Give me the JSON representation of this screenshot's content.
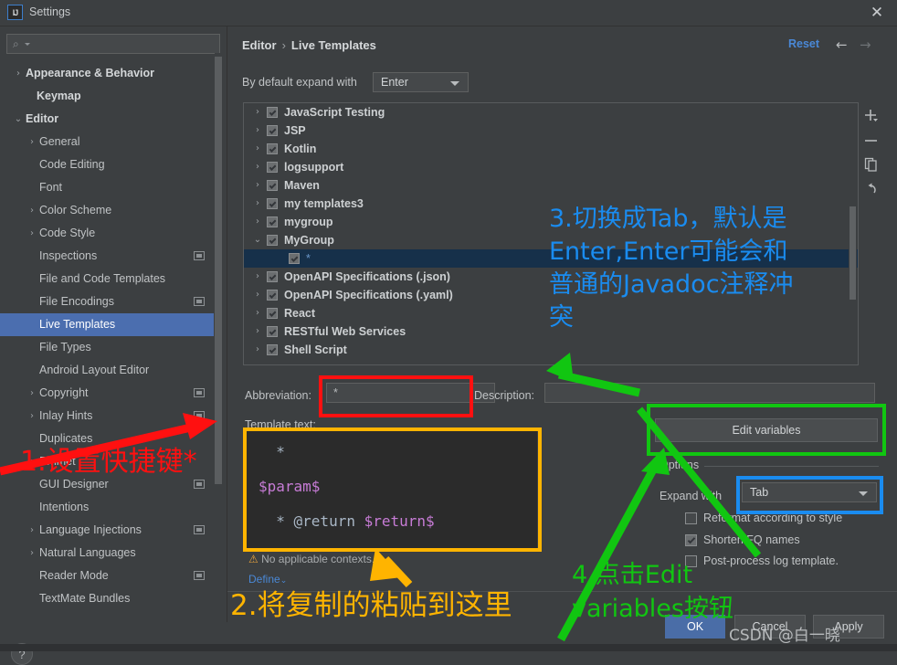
{
  "window": {
    "title": "Settings",
    "app_icon": "IJ",
    "close_icon": "✕"
  },
  "sidebar": {
    "search_placeholder": "",
    "search_icon": "⌕",
    "items": [
      {
        "label": "Appearance & Behavior",
        "arrow": "›",
        "indent": 14,
        "bold": true,
        "chip": false,
        "selected": false
      },
      {
        "label": "Keymap",
        "arrow": "",
        "indent": 40,
        "bold": true,
        "chip": false,
        "selected": false
      },
      {
        "label": "Editor",
        "arrow": "⌄",
        "indent": 14,
        "bold": true,
        "chip": false,
        "selected": false
      },
      {
        "label": "General",
        "arrow": "›",
        "indent": 29,
        "bold": false,
        "chip": false,
        "selected": false
      },
      {
        "label": "Code Editing",
        "arrow": "",
        "indent": 43,
        "bold": false,
        "chip": false,
        "selected": false
      },
      {
        "label": "Font",
        "arrow": "",
        "indent": 43,
        "bold": false,
        "chip": false,
        "selected": false
      },
      {
        "label": "Color Scheme",
        "arrow": "›",
        "indent": 29,
        "bold": false,
        "chip": false,
        "selected": false
      },
      {
        "label": "Code Style",
        "arrow": "›",
        "indent": 29,
        "bold": false,
        "chip": false,
        "selected": false
      },
      {
        "label": "Inspections",
        "arrow": "",
        "indent": 43,
        "bold": false,
        "chip": true,
        "selected": false
      },
      {
        "label": "File and Code Templates",
        "arrow": "",
        "indent": 43,
        "bold": false,
        "chip": false,
        "selected": false
      },
      {
        "label": "File Encodings",
        "arrow": "",
        "indent": 43,
        "bold": false,
        "chip": true,
        "selected": false
      },
      {
        "label": "Live Templates",
        "arrow": "",
        "indent": 43,
        "bold": false,
        "chip": false,
        "selected": true
      },
      {
        "label": "File Types",
        "arrow": "",
        "indent": 43,
        "bold": false,
        "chip": false,
        "selected": false
      },
      {
        "label": "Android Layout Editor",
        "arrow": "",
        "indent": 43,
        "bold": false,
        "chip": false,
        "selected": false
      },
      {
        "label": "Copyright",
        "arrow": "›",
        "indent": 29,
        "bold": false,
        "chip": true,
        "selected": false
      },
      {
        "label": "Inlay Hints",
        "arrow": "›",
        "indent": 29,
        "bold": false,
        "chip": true,
        "selected": false
      },
      {
        "label": "Duplicates",
        "arrow": "",
        "indent": 43,
        "bold": false,
        "chip": false,
        "selected": false
      },
      {
        "label": "Emmet",
        "arrow": "›",
        "indent": 29,
        "bold": false,
        "chip": false,
        "selected": false
      },
      {
        "label": "GUI Designer",
        "arrow": "",
        "indent": 43,
        "bold": false,
        "chip": true,
        "selected": false
      },
      {
        "label": "Intentions",
        "arrow": "",
        "indent": 43,
        "bold": false,
        "chip": false,
        "selected": false
      },
      {
        "label": "Language Injections",
        "arrow": "›",
        "indent": 29,
        "bold": false,
        "chip": true,
        "selected": false
      },
      {
        "label": "Natural Languages",
        "arrow": "›",
        "indent": 29,
        "bold": false,
        "chip": false,
        "selected": false
      },
      {
        "label": "Reader Mode",
        "arrow": "",
        "indent": 43,
        "bold": false,
        "chip": true,
        "selected": false
      },
      {
        "label": "TextMate Bundles",
        "arrow": "",
        "indent": 43,
        "bold": false,
        "chip": false,
        "selected": false
      }
    ],
    "help_icon": "?"
  },
  "header": {
    "breadcrumb_parent": "Editor",
    "breadcrumb_sep": "›",
    "breadcrumb_current": "Live Templates",
    "reset_label": "Reset",
    "back_icon": "←",
    "forward_icon": "→"
  },
  "expand_default": {
    "label": "By default expand with",
    "value": "Enter"
  },
  "templates": [
    {
      "label": "JavaScript Testing",
      "arrow": "›",
      "checked": true,
      "child": false,
      "selected": false
    },
    {
      "label": "JSP",
      "arrow": "›",
      "checked": true,
      "child": false,
      "selected": false
    },
    {
      "label": "Kotlin",
      "arrow": "›",
      "checked": true,
      "child": false,
      "selected": false
    },
    {
      "label": "logsupport",
      "arrow": "›",
      "checked": true,
      "child": false,
      "selected": false
    },
    {
      "label": "Maven",
      "arrow": "›",
      "checked": true,
      "child": false,
      "selected": false
    },
    {
      "label": "my templates3",
      "arrow": "›",
      "checked": true,
      "child": false,
      "selected": false
    },
    {
      "label": "mygroup",
      "arrow": "›",
      "checked": true,
      "child": false,
      "selected": false
    },
    {
      "label": "MyGroup",
      "arrow": "⌄",
      "checked": true,
      "child": false,
      "selected": false
    },
    {
      "label": "*",
      "arrow": "",
      "checked": true,
      "child": true,
      "selected": true
    },
    {
      "label": "OpenAPI Specifications (.json)",
      "arrow": "›",
      "checked": true,
      "child": false,
      "selected": false
    },
    {
      "label": "OpenAPI Specifications (.yaml)",
      "arrow": "›",
      "checked": true,
      "child": false,
      "selected": false
    },
    {
      "label": "React",
      "arrow": "›",
      "checked": true,
      "child": false,
      "selected": false
    },
    {
      "label": "RESTful Web Services",
      "arrow": "›",
      "checked": true,
      "child": false,
      "selected": false
    },
    {
      "label": "Shell Script",
      "arrow": "›",
      "checked": true,
      "child": false,
      "selected": false
    }
  ],
  "list_toolbar": [
    {
      "name": "add-template-button",
      "icon": "plus"
    },
    {
      "name": "remove-template-button",
      "icon": "minus"
    },
    {
      "name": "duplicate-template-button",
      "icon": "copy"
    },
    {
      "name": "restore-defaults-button",
      "icon": "undo"
    }
  ],
  "form": {
    "abbreviation_label": "Abbreviation:",
    "abbreviation_value": "*",
    "description_label": "Description:",
    "description_value": "",
    "template_text_label": "Template text:",
    "template_lines": [
      "  *",
      "$param$",
      "  * @return $return$"
    ],
    "warning_icon": "⚠",
    "warning_text": "No applicable contexts.",
    "define_label": "Define",
    "define_caret": "⌄"
  },
  "options": {
    "edit_variables_label": "Edit variables",
    "section_title": "Options",
    "expand_with_label": "Expand with",
    "expand_with_value": "Tab",
    "checkboxes": [
      {
        "label": "Reformat according to style",
        "checked": false
      },
      {
        "label": "Shorten FQ names",
        "checked": true
      },
      {
        "label": "Post-process log template.",
        "checked": false
      }
    ]
  },
  "buttons": {
    "ok": "OK",
    "cancel": "Cancel",
    "apply": "Apply"
  },
  "annotations": [
    {
      "id": "a1",
      "text": "1.设置快捷键*",
      "color": "#ff1010"
    },
    {
      "id": "a2",
      "text": "2.将复制的粘贴到这里",
      "color": "#ffb400"
    },
    {
      "id": "a3",
      "text": "3.切换成Tab，默认是\nEnter,Enter可能会和\n普通的Javadoc注释冲\n突",
      "color": "#1a8cf0"
    },
    {
      "id": "a4",
      "text": "4.点击Edit\nvariables按钮",
      "color": "#11c611"
    }
  ],
  "watermark": "CSDN @白一晓"
}
